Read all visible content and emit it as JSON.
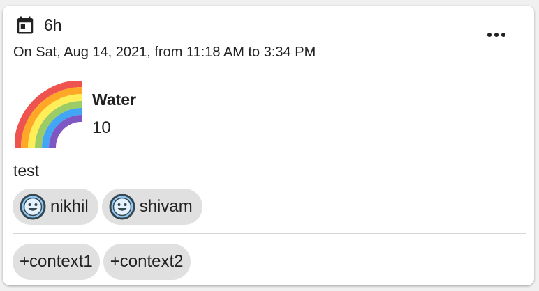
{
  "header": {
    "duration": "6h",
    "icon": "calendar-icon"
  },
  "date_range": "On Sat, Aug 14, 2021, from 11:18 AM to 3:34 PM",
  "activity": {
    "icon": "rainbow-icon",
    "name": "Water",
    "value": "10"
  },
  "note": "test",
  "people": [
    {
      "name": "nikhil",
      "icon": "smiley-icon"
    },
    {
      "name": "shivam",
      "icon": "smiley-icon"
    }
  ],
  "contexts": [
    {
      "label": "+context1"
    },
    {
      "label": "+context2"
    }
  ],
  "colors": {
    "chip_bg": "#e0e0e0",
    "text": "#222222",
    "card_bg": "#ffffff"
  }
}
